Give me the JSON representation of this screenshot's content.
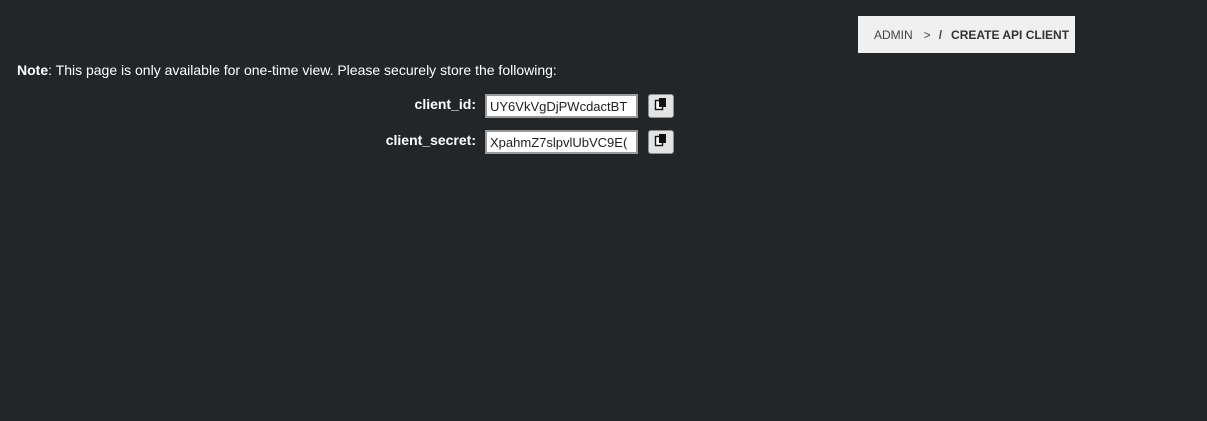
{
  "breadcrumb": {
    "root": "ADMIN",
    "separator": ">",
    "divider": "/",
    "current": "CREATE API CLIENT"
  },
  "note": {
    "prefix": "Note",
    "text": ": This page is only available for one-time view. Please securely store the following:"
  },
  "fields": {
    "client_id": {
      "label": "client_id:",
      "value": "UY6VkVgDjPWcdactBT"
    },
    "client_secret": {
      "label": "client_secret:",
      "value": "XpahmZ7slpvlUbVC9E("
    }
  },
  "icons": {
    "copy": "copy-icon"
  },
  "colors": {
    "background": "#232629",
    "breadcrumb_bg": "#f0f0f0",
    "text": "#ffffff"
  }
}
